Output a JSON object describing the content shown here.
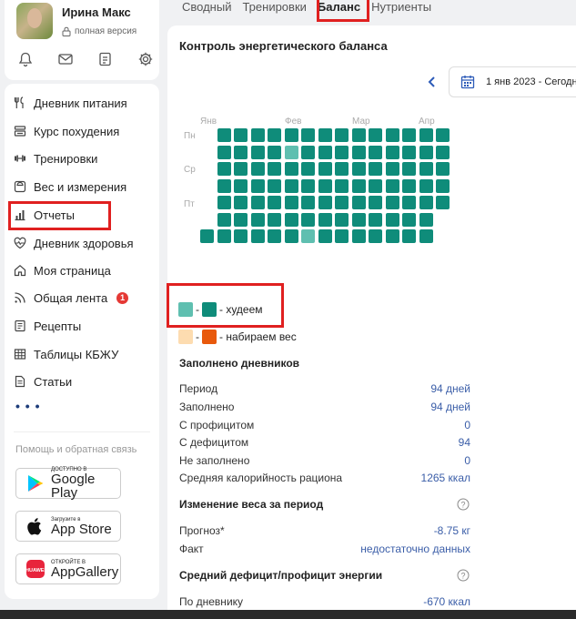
{
  "user": {
    "name": "Ирина Макс",
    "status": "полная версия"
  },
  "sidebar": {
    "items": [
      {
        "label": "Дневник питания",
        "icon": "fork-knife-icon"
      },
      {
        "label": "Курс похудения",
        "icon": "course-icon"
      },
      {
        "label": "Тренировки",
        "icon": "dumbbell-icon"
      },
      {
        "label": "Вес и измерения",
        "icon": "scale-icon"
      },
      {
        "label": "Отчеты",
        "icon": "chart-icon"
      },
      {
        "label": "Дневник здоровья",
        "icon": "heart-pulse-icon"
      },
      {
        "label": "Моя страница",
        "icon": "home-icon"
      },
      {
        "label": "Общая лента",
        "icon": "feed-icon",
        "badge": "1"
      },
      {
        "label": "Рецепты",
        "icon": "recipe-icon"
      },
      {
        "label": "Таблицы КБЖУ",
        "icon": "table-icon"
      },
      {
        "label": "Статьи",
        "icon": "article-icon"
      }
    ],
    "more": "• • •",
    "help": "Помощь и обратная связь",
    "stores": [
      {
        "small": "ДОСТУПНО В",
        "big": "Google Play",
        "icon": "google-play-icon"
      },
      {
        "small": "Загрузите в",
        "big": "App Store",
        "icon": "apple-icon"
      },
      {
        "small": "ОТКРОЙТЕ В",
        "big": "AppGallery",
        "icon": "huawei-icon"
      }
    ]
  },
  "tabs": [
    "Сводный",
    "Тренировки",
    "Баланс",
    "Нутриенты"
  ],
  "active_tab": "Баланс",
  "card": {
    "title": "Контроль энергетического баланса",
    "date_range": "1 янв 2023 - Сегодня"
  },
  "heatmap": {
    "months": [
      "Янв",
      "Фев",
      "Мар",
      "Апр"
    ],
    "days": [
      "Пн",
      "Ср",
      "Пт"
    ],
    "colors": {
      "deficit_light": "#5fbfb0",
      "deficit_dark": "#0f8c7a",
      "surplus_light": "#fddcb0",
      "surplus_dark": "#e8590c"
    },
    "columns": [
      [
        "",
        "",
        "",
        "",
        "",
        "",
        "d"
      ],
      [
        "d",
        "d",
        "d",
        "d",
        "d",
        "d",
        "d"
      ],
      [
        "d",
        "d",
        "d",
        "d",
        "d",
        "d",
        "d"
      ],
      [
        "d",
        "d",
        "d",
        "d",
        "d",
        "d",
        "d"
      ],
      [
        "d",
        "d",
        "d",
        "d",
        "d",
        "d",
        "d"
      ],
      [
        "d",
        "l",
        "d",
        "d",
        "d",
        "d",
        "d"
      ],
      [
        "d",
        "d",
        "d",
        "d",
        "d",
        "d",
        "l"
      ],
      [
        "d",
        "d",
        "d",
        "d",
        "d",
        "d",
        "d"
      ],
      [
        "d",
        "d",
        "d",
        "d",
        "d",
        "d",
        "d"
      ],
      [
        "d",
        "d",
        "d",
        "d",
        "d",
        "d",
        "d"
      ],
      [
        "d",
        "d",
        "d",
        "d",
        "d",
        "d",
        "d"
      ],
      [
        "d",
        "d",
        "d",
        "d",
        "d",
        "d",
        "d"
      ],
      [
        "d",
        "d",
        "d",
        "d",
        "d",
        "d",
        "d"
      ],
      [
        "d",
        "d",
        "d",
        "d",
        "d",
        "d",
        "d"
      ],
      [
        "d",
        "d",
        "d",
        "d",
        "d",
        "",
        ""
      ]
    ]
  },
  "legend": [
    {
      "label": "- худеем"
    },
    {
      "label": "- набираем вес"
    }
  ],
  "filled": {
    "title": "Заполнено дневников",
    "rows": [
      {
        "k": "Период",
        "v": "94 дней"
      },
      {
        "k": "Заполнено",
        "v": "94 дней"
      },
      {
        "k": "С профицитом",
        "v": "0"
      },
      {
        "k": "С дефицитом",
        "v": "94"
      },
      {
        "k": "Не заполнено",
        "v": "0"
      },
      {
        "k": "Средняя калорийность рациона",
        "v": "1265 ккал"
      }
    ]
  },
  "weight": {
    "title": "Изменение веса за период",
    "rows": [
      {
        "k": "Прогноз*",
        "v": "-8.75 кг"
      },
      {
        "k": "Факт",
        "v": "недостаточно данных"
      }
    ]
  },
  "energy": {
    "title": "Средний дефицит/профицит энергии",
    "rows": [
      {
        "k": "По дневнику",
        "v": "-670 ккал"
      }
    ]
  }
}
